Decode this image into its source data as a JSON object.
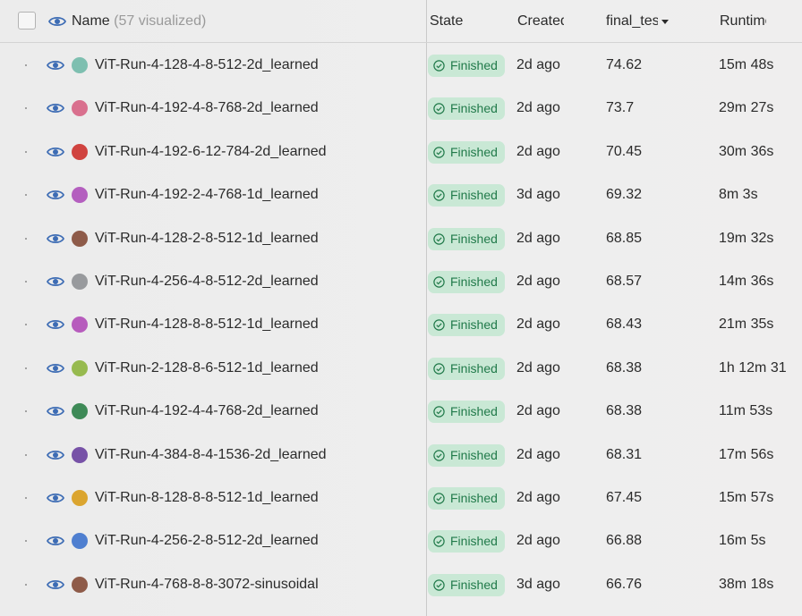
{
  "header": {
    "name_label": "Name",
    "name_count": "(57 visualized)",
    "state_label": "State",
    "created_label": "Created",
    "final_label": "final_test_acc",
    "runtime_label": "Runtime"
  },
  "colors": {
    "eye": "#3d6cb4",
    "badge_bg": "#c9e8d5",
    "badge_text": "#217a4a"
  },
  "runs": [
    {
      "name": "ViT-Run-4-128-4-8-512-2d_learned",
      "color": "#7ebfb0",
      "state": "Finished",
      "created": "2d ago",
      "final_test_acc": "74.62",
      "runtime": "15m 48s"
    },
    {
      "name": "ViT-Run-4-192-4-8-768-2d_learned",
      "color": "#d9708e",
      "state": "Finished",
      "created": "2d ago",
      "final_test_acc": "73.7",
      "runtime": "29m 27s"
    },
    {
      "name": "ViT-Run-4-192-6-12-784-2d_learned",
      "color": "#d0433f",
      "state": "Finished",
      "created": "2d ago",
      "final_test_acc": "70.45",
      "runtime": "30m 36s"
    },
    {
      "name": "ViT-Run-4-192-2-4-768-1d_learned",
      "color": "#b45fbf",
      "state": "Finished",
      "created": "3d ago",
      "final_test_acc": "69.32",
      "runtime": "8m 3s"
    },
    {
      "name": "ViT-Run-4-128-2-8-512-1d_learned",
      "color": "#8e5b49",
      "state": "Finished",
      "created": "2d ago",
      "final_test_acc": "68.85",
      "runtime": "19m 32s"
    },
    {
      "name": "ViT-Run-4-256-4-8-512-2d_learned",
      "color": "#989a9d",
      "state": "Finished",
      "created": "2d ago",
      "final_test_acc": "68.57",
      "runtime": "14m 36s"
    },
    {
      "name": "ViT-Run-4-128-8-8-512-1d_learned",
      "color": "#b75cbd",
      "state": "Finished",
      "created": "2d ago",
      "final_test_acc": "68.43",
      "runtime": "21m 35s"
    },
    {
      "name": "ViT-Run-2-128-8-6-512-1d_learned",
      "color": "#97ba4f",
      "state": "Finished",
      "created": "2d ago",
      "final_test_acc": "68.38",
      "runtime": "1h 12m 31"
    },
    {
      "name": "ViT-Run-4-192-4-4-768-2d_learned",
      "color": "#3e8a57",
      "state": "Finished",
      "created": "2d ago",
      "final_test_acc": "68.38",
      "runtime": "11m 53s"
    },
    {
      "name": "ViT-Run-4-384-8-4-1536-2d_learned",
      "color": "#7752a7",
      "state": "Finished",
      "created": "2d ago",
      "final_test_acc": "68.31",
      "runtime": "17m 56s"
    },
    {
      "name": "ViT-Run-8-128-8-8-512-1d_learned",
      "color": "#dba52f",
      "state": "Finished",
      "created": "2d ago",
      "final_test_acc": "67.45",
      "runtime": "15m 57s"
    },
    {
      "name": "ViT-Run-4-256-2-8-512-2d_learned",
      "color": "#4f7fd0",
      "state": "Finished",
      "created": "2d ago",
      "final_test_acc": "66.88",
      "runtime": "16m 5s"
    },
    {
      "name": "ViT-Run-4-768-8-8-3072-sinusoidal",
      "color": "#8e5b49",
      "state": "Finished",
      "created": "3d ago",
      "final_test_acc": "66.76",
      "runtime": "38m 18s"
    }
  ]
}
